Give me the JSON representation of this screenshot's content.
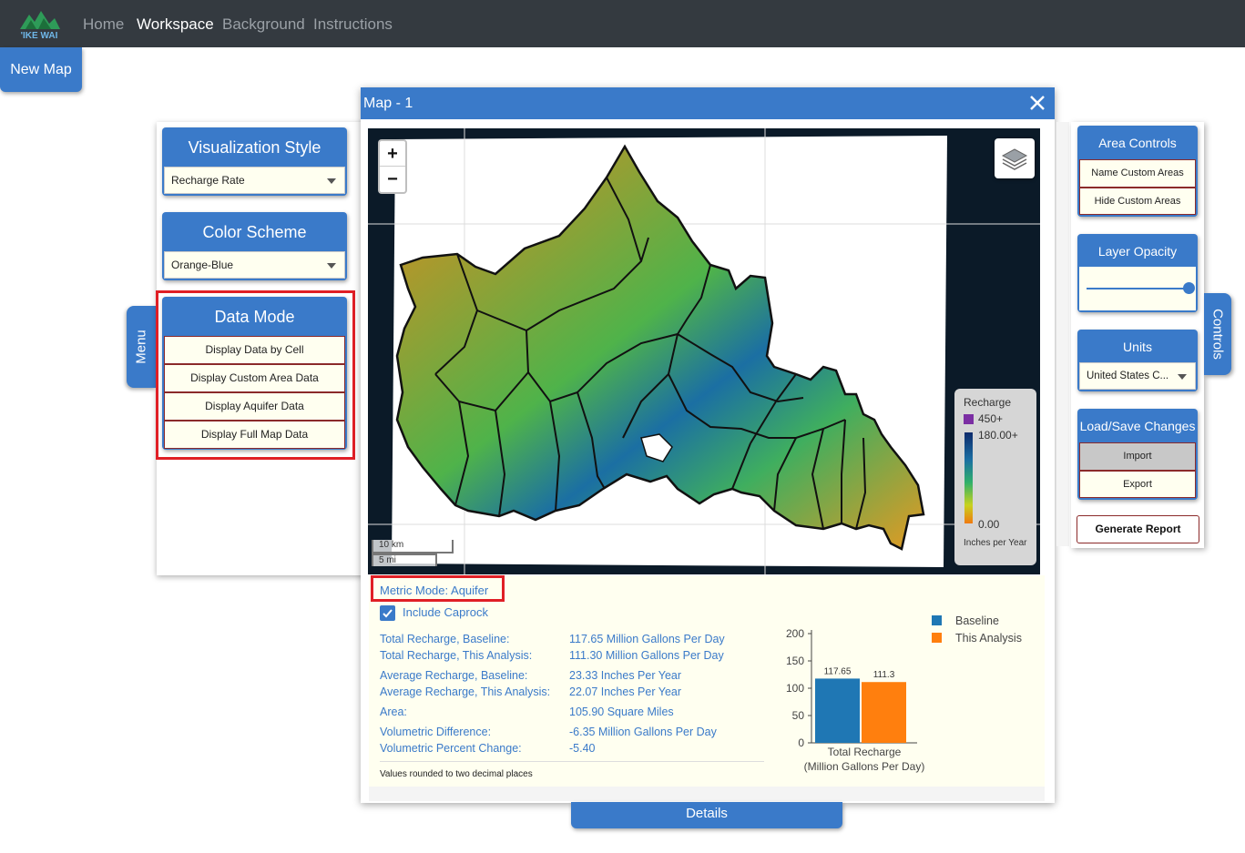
{
  "navbar": {
    "logo_text": "'IKE WAI",
    "links": [
      "Home",
      "Workspace",
      "Background",
      "Instructions"
    ]
  },
  "new_map_label": "New Map",
  "menu_tab_label": "Menu",
  "visualization": {
    "title": "Visualization Style",
    "selected": "Recharge Rate"
  },
  "color_scheme": {
    "title": "Color Scheme",
    "selected": "Orange-Blue"
  },
  "data_mode": {
    "title": "Data Mode",
    "options": [
      "Display Data by Cell",
      "Display Custom Area Data",
      "Display Aquifer Data",
      "Display Full Map Data"
    ]
  },
  "map_window": {
    "title": "Map - 1"
  },
  "map": {
    "zoom_in": "+",
    "zoom_out": "−",
    "scale_km": "10 km",
    "scale_mi": "5 mi",
    "legend": {
      "title": "Recharge",
      "max_label": "450+",
      "high_label": "180.00+",
      "low_label": "0.00",
      "units": "Inches per Year"
    }
  },
  "details": {
    "metric_mode": "Metric Mode: Aquifer",
    "include_caprock": "Include Caprock",
    "stats": [
      {
        "label": "Total Recharge, Baseline:",
        "value": "117.65 Million Gallons Per Day"
      },
      {
        "label": "Total Recharge, This Analysis:",
        "value": "111.30 Million Gallons Per Day"
      },
      {
        "label": "Average Recharge, Baseline:",
        "value": "23.33 Inches Per Year"
      },
      {
        "label": "Average Recharge, This Analysis:",
        "value": "22.07 Inches Per Year"
      },
      {
        "label": "Area:",
        "value": "105.90 Square Miles"
      },
      {
        "label": "Volumetric Difference:",
        "value": "-6.35 Million Gallons Per Day"
      },
      {
        "label": "Volumetric Percent Change:",
        "value": "-5.40"
      }
    ],
    "note": "Values rounded to two decimal places",
    "button": "Details"
  },
  "chart_data": {
    "type": "bar",
    "categories": [
      "Total Recharge"
    ],
    "series": [
      {
        "name": "Baseline",
        "values": [
          117.65
        ],
        "label": "117.65",
        "color": "#1f77b4"
      },
      {
        "name": "This Analysis",
        "values": [
          111.3
        ],
        "label": "111.3",
        "color": "#ff7f0e"
      }
    ],
    "xlabel": "(Million Gallons Per Day)",
    "ylim": [
      0,
      200
    ],
    "yticks": [
      "0",
      "50",
      "100",
      "150",
      "200"
    ],
    "legend": "top-right"
  },
  "controls_tab_label": "Controls",
  "area_controls": {
    "title": "Area Controls",
    "buttons": [
      "Name Custom Areas",
      "Hide Custom Areas"
    ]
  },
  "layer_opacity": {
    "title": "Layer Opacity",
    "value": 1.0
  },
  "units": {
    "title": "Units",
    "selected": "United States C..."
  },
  "load_save": {
    "title": "Load/Save Changes",
    "buttons": [
      "Import",
      "Export"
    ]
  },
  "generate_report": "Generate Report",
  "colors": {
    "accent": "#3a7ac9",
    "navbar": "#343a40",
    "highlight": "#e01f26",
    "panel_bg": "#fffff0"
  }
}
